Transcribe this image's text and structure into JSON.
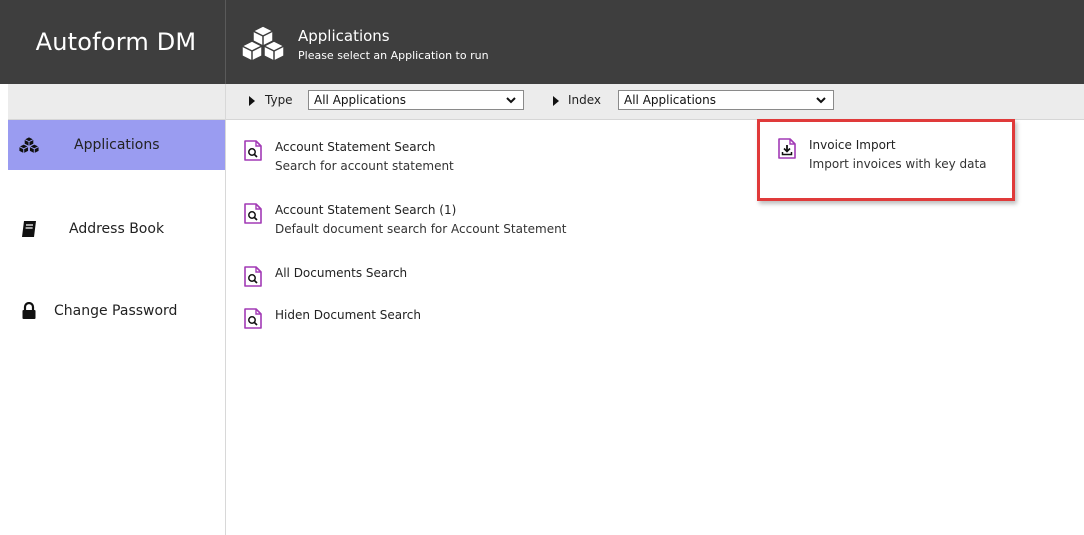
{
  "app": {
    "brand": "Autoform DM"
  },
  "header": {
    "title": "Applications",
    "subtitle": "Please select an Application to run",
    "icon": "cubes-icon"
  },
  "sidebar": {
    "items": [
      {
        "label": "Applications",
        "icon": "cubes-icon",
        "active": true
      },
      {
        "label": "Address Book",
        "icon": "address-book-icon",
        "active": false
      },
      {
        "label": "Change Password",
        "icon": "lock-icon",
        "active": false
      }
    ]
  },
  "filters": {
    "type_label": "Type",
    "type_value": "All Applications",
    "index_label": "Index",
    "index_value": "All Applications"
  },
  "applications": [
    {
      "name": "Account Statement Search",
      "description": "Search for account statement",
      "icon": "document-search-icon"
    },
    {
      "name": "Account Statement Search (1)",
      "description": "Default document search for Account Statement",
      "icon": "document-search-icon"
    },
    {
      "name": "All Documents Search",
      "description": "",
      "icon": "document-search-icon"
    },
    {
      "name": "Hiden Document Search",
      "description": "",
      "icon": "document-search-icon"
    },
    {
      "name": "Invoice Import",
      "description": "Import invoices with key data",
      "icon": "document-import-icon"
    }
  ],
  "colors": {
    "header_bg": "#3e3e3e",
    "active_item": "#9a9cf1",
    "doc_icon": "#a23ab5",
    "highlight": "#e03a3a"
  }
}
